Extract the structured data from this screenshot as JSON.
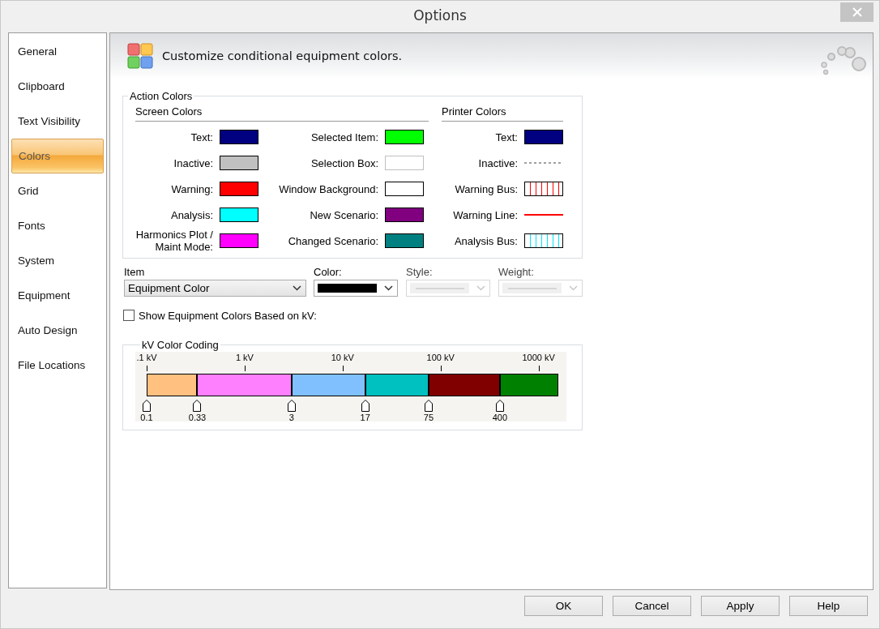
{
  "window": {
    "title": "Options"
  },
  "sidebar": {
    "items": [
      {
        "label": "General",
        "selected": false
      },
      {
        "label": "Clipboard",
        "selected": false
      },
      {
        "label": "Text Visibility",
        "selected": false
      },
      {
        "label": "Colors",
        "selected": true
      },
      {
        "label": "Grid",
        "selected": false
      },
      {
        "label": "Fonts",
        "selected": false
      },
      {
        "label": "System",
        "selected": false
      },
      {
        "label": "Equipment",
        "selected": false
      },
      {
        "label": "Auto Design",
        "selected": false
      },
      {
        "label": "File Locations",
        "selected": false
      }
    ]
  },
  "header": {
    "text": "Customize conditional equipment colors."
  },
  "action_colors": {
    "title": "Action Colors",
    "screen_colors": {
      "title": "Screen Colors",
      "columns": [
        [
          {
            "label": "Text:",
            "kind": "fill",
            "color": "#000080"
          },
          {
            "label": "Inactive:",
            "kind": "fill",
            "color": "#c0c0c0"
          },
          {
            "label": "Warning:",
            "kind": "fill",
            "color": "#ff0000"
          },
          {
            "label": "Analysis:",
            "kind": "fill",
            "color": "#00ffff"
          },
          {
            "label": "Harmonics Plot / Maint Mode:",
            "kind": "fill",
            "color": "#ff00ff"
          }
        ],
        [
          {
            "label": "Selected Item:",
            "kind": "fill",
            "color": "#00ff00"
          },
          {
            "label": "Selection Box:",
            "kind": "outline",
            "color": "#c0c0c0"
          },
          {
            "label": "Window Background:",
            "kind": "fill",
            "color": "#ffffff"
          },
          {
            "label": "New Scenario:",
            "kind": "fill",
            "color": "#800080"
          },
          {
            "label": "Changed Scenario:",
            "kind": "fill",
            "color": "#008080"
          }
        ]
      ]
    },
    "printer_colors": {
      "title": "Printer Colors",
      "items": [
        {
          "label": "Text:",
          "kind": "fill",
          "color": "#000080"
        },
        {
          "label": "Inactive:",
          "kind": "dashed",
          "color": "#a0a0a0"
        },
        {
          "label": "Warning Bus:",
          "kind": "bus",
          "color": "#ff0000"
        },
        {
          "label": "Warning Line:",
          "kind": "line",
          "color": "#ff0000"
        },
        {
          "label": "Analysis Bus:",
          "kind": "bus",
          "color": "#00e5ff"
        }
      ]
    }
  },
  "item_settings": [
    {
      "label": "Item",
      "kind": "text",
      "value": "Equipment Color",
      "disabled": false
    },
    {
      "label": "Color:",
      "kind": "color",
      "color": "#000000",
      "disabled": false
    },
    {
      "label": "Style:",
      "kind": "line",
      "disabled": true
    },
    {
      "label": "Weight:",
      "kind": "line",
      "disabled": true
    }
  ],
  "show_kv_colors": {
    "label": "Show Equipment Colors Based on kV:",
    "checked": false
  },
  "kv_color_coding": {
    "title": "kV Color Coding",
    "scale_labels": [
      {
        "label": ".1 kV",
        "level": 0
      },
      {
        "label": "1 kV",
        "level": 0.238
      },
      {
        "label": "10 kV",
        "level": 0.476
      },
      {
        "label": "100 kV",
        "level": 0.714
      },
      {
        "label": "1000 kV",
        "level": 0.952
      }
    ],
    "thresholds": [
      {
        "label": "0.1",
        "level": 0,
        "color": "#ffc080"
      },
      {
        "label": "0.33",
        "level": 0.123,
        "color": "#ff80ff"
      },
      {
        "label": "3",
        "level": 0.352,
        "color": "#80c0ff"
      },
      {
        "label": "17",
        "level": 0.531,
        "color": "#00c0c0"
      },
      {
        "label": "75",
        "level": 0.685,
        "color": "#800000"
      },
      {
        "label": "400",
        "level": 0.858,
        "color": "#008000"
      }
    ]
  },
  "buttons": [
    "OK",
    "Cancel",
    "Apply",
    "Help"
  ]
}
